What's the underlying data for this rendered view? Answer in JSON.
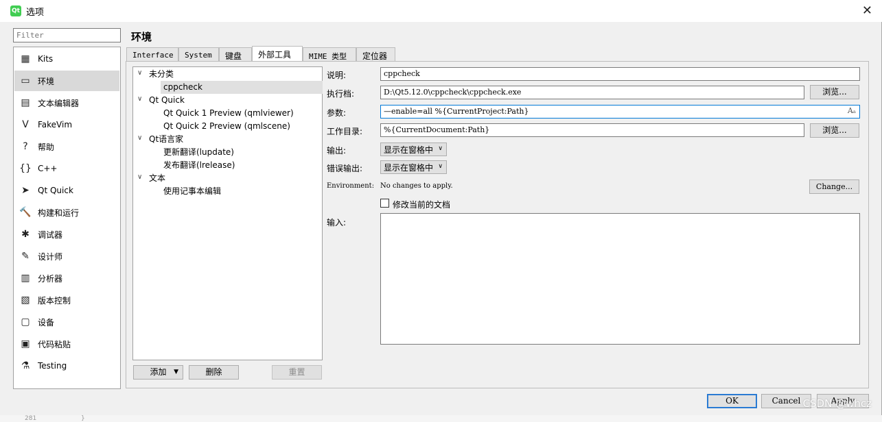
{
  "window": {
    "title": "选项",
    "app_icon": "Qt"
  },
  "filter": {
    "placeholder": "Filter"
  },
  "sidebar": {
    "items": [
      {
        "label": "Kits",
        "icon": "kits-icon",
        "glyph": "▦"
      },
      {
        "label": "环境",
        "icon": "monitor-icon",
        "glyph": "▭"
      },
      {
        "label": "文本编辑器",
        "icon": "text-editor-icon",
        "glyph": "▤"
      },
      {
        "label": "FakeVim",
        "icon": "fakevim-icon",
        "glyph": "V"
      },
      {
        "label": "帮助",
        "icon": "help-icon",
        "glyph": "?"
      },
      {
        "label": "C++",
        "icon": "cpp-icon",
        "glyph": "{}"
      },
      {
        "label": "Qt Quick",
        "icon": "qtquick-icon",
        "glyph": "➤"
      },
      {
        "label": "构建和运行",
        "icon": "hammer-icon",
        "glyph": "🔨"
      },
      {
        "label": "调试器",
        "icon": "bug-icon",
        "glyph": "✱"
      },
      {
        "label": "设计师",
        "icon": "pencil-icon",
        "glyph": "✎"
      },
      {
        "label": "分析器",
        "icon": "analyzer-icon",
        "glyph": "▥"
      },
      {
        "label": "版本控制",
        "icon": "version-control-icon",
        "glyph": "▧"
      },
      {
        "label": "设备",
        "icon": "device-icon",
        "glyph": "▢"
      },
      {
        "label": "代码粘贴",
        "icon": "clipboard-icon",
        "glyph": "▣"
      },
      {
        "label": "Testing",
        "icon": "testing-icon",
        "glyph": "⚗"
      }
    ],
    "active_index": 1
  },
  "page": {
    "title": "环境"
  },
  "tabs": [
    {
      "label": "Interface"
    },
    {
      "label": "System"
    },
    {
      "label": "键盘"
    },
    {
      "label": "外部工具"
    },
    {
      "label": "MIME 类型"
    },
    {
      "label": "定位器"
    }
  ],
  "active_tab": 3,
  "tree": {
    "groups": [
      {
        "label": "未分类",
        "children": [
          "cppcheck"
        ]
      },
      {
        "label": "Qt Quick",
        "children": [
          "Qt Quick 1 Preview (qmlviewer)",
          "Qt Quick 2 Preview (qmlscene)"
        ]
      },
      {
        "label": "Qt语言家",
        "children": [
          "更新翻译(lupdate)",
          "发布翻译(lrelease)"
        ]
      },
      {
        "label": "文本",
        "children": [
          "使用记事本编辑"
        ]
      }
    ],
    "selected": "cppcheck"
  },
  "tree_buttons": {
    "add": "添加",
    "delete": "删除",
    "reset": "重置"
  },
  "form": {
    "description": {
      "label": "说明:",
      "value": "cppcheck"
    },
    "executable": {
      "label": "执行档:",
      "value": "D:\\Qt5.12.0\\cppcheck\\cppcheck.exe",
      "browse": "浏览..."
    },
    "arguments": {
      "label": "参数:",
      "value": "—enable=all %{CurrentProject:Path}"
    },
    "working_dir": {
      "label": "工作目录:",
      "value": "%{CurrentDocument:Path}",
      "browse": "浏览..."
    },
    "output": {
      "label": "输出:",
      "value": "显示在窗格中"
    },
    "error_output": {
      "label": "错误输出:",
      "value": "显示在窗格中"
    },
    "environment": {
      "label": "Environment:",
      "value": "No changes to apply.",
      "change": "Change..."
    },
    "modify_doc": {
      "label": "修改当前的文档",
      "checked": false
    },
    "input": {
      "label": "输入:",
      "value": ""
    }
  },
  "dialog_buttons": {
    "ok": "OK",
    "cancel": "Cancel",
    "apply": "Apply"
  },
  "watermark": "CSDN @whcz",
  "below": {
    "line_number": "281",
    "code": "}"
  }
}
